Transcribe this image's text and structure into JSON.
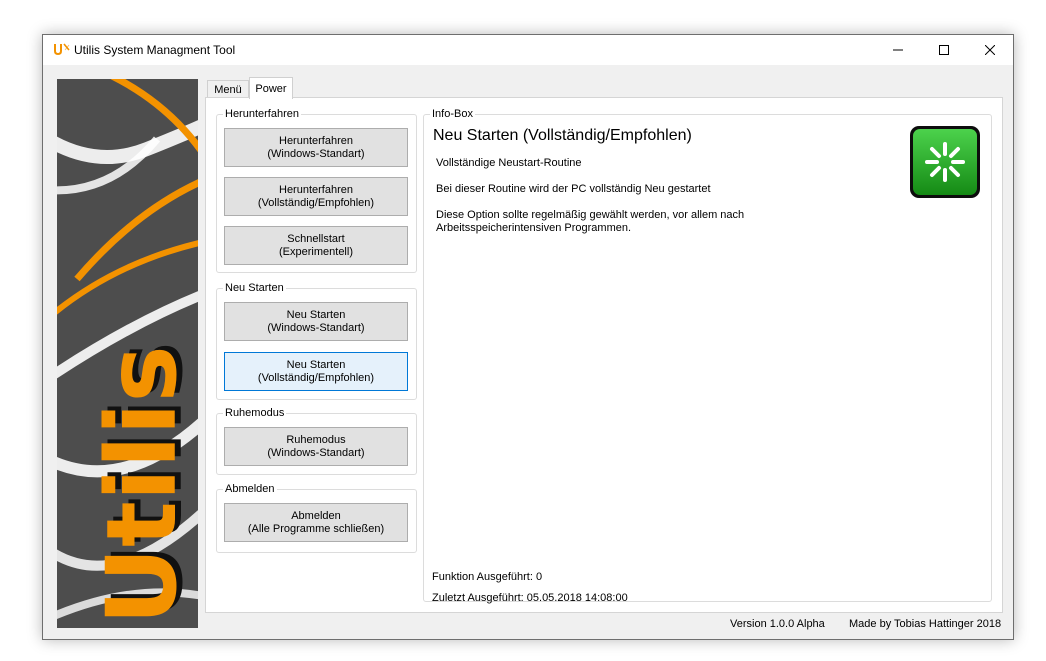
{
  "window": {
    "title": "Utilis System Managment Tool",
    "controls": {
      "minimize": "—",
      "maximize": "☐",
      "close": "✕"
    }
  },
  "banner": {
    "logo_text": "Utilis"
  },
  "tabs": [
    {
      "label": "Menü",
      "active": false
    },
    {
      "label": "Power",
      "active": true
    }
  ],
  "groups": {
    "shutdown": {
      "title": "Herunterfahren",
      "buttons": [
        {
          "line1": "Herunterfahren",
          "line2": "(Windows-Standart)"
        },
        {
          "line1": "Herunterfahren",
          "line2": "(Vollständig/Empfohlen)"
        },
        {
          "line1": "Schnellstart",
          "line2": "(Experimentell)"
        }
      ]
    },
    "restart": {
      "title": "Neu Starten",
      "buttons": [
        {
          "line1": "Neu Starten",
          "line2": "(Windows-Standart)"
        },
        {
          "line1": "Neu Starten",
          "line2": "(Vollständig/Empfohlen)"
        }
      ]
    },
    "sleep": {
      "title": "Ruhemodus",
      "buttons": [
        {
          "line1": "Ruhemodus",
          "line2": "(Windows-Standart)"
        }
      ]
    },
    "logoff": {
      "title": "Abmelden",
      "buttons": [
        {
          "line1": "Abmelden",
          "line2": "(Alle Programme schließen)"
        }
      ]
    }
  },
  "info_box": {
    "title": "Info-Box",
    "heading": "Neu Starten (Vollständig/Empfohlen)",
    "subtitle": "Vollständige Neustart-Routine",
    "description": "Bei dieser Routine wird der PC vollständig Neu gestartet",
    "note_line1": "Diese Option sollte regelmäßig gewählt werden, vor allem nach",
    "note_line2": "Arbeitsspeicherintensiven Programmen.",
    "executed_count": "Funktion Ausgeführt: 0",
    "last_executed": "Zuletzt Ausgeführt: 05.05.2018 14:08:00",
    "icon": "restart-icon"
  },
  "footer": {
    "version": "Version 1.0.0 Alpha",
    "author": "Made by Tobias Hattinger 2018"
  },
  "colors": {
    "accent_orange": "#f39200",
    "banner_bg": "#4d4d4d",
    "restart_green": "#22a822",
    "hover_border": "#0078d7"
  }
}
